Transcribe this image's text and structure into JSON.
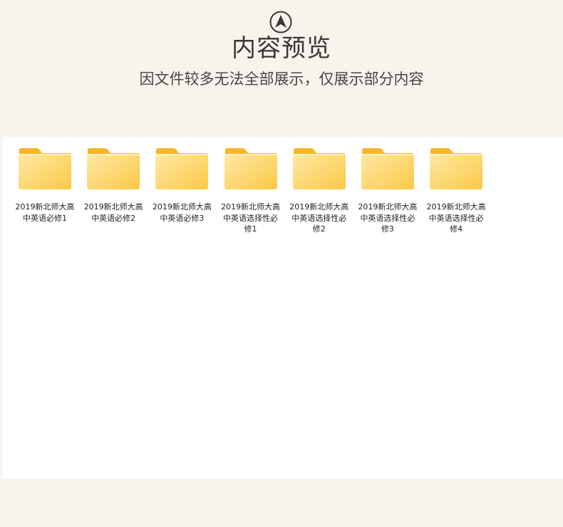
{
  "header": {
    "logo_icon": "up-arrow-circle-icon",
    "title": "内容预览",
    "subtitle": "因文件较多无法全部展示，仅展示部分内容"
  },
  "folders": [
    {
      "label": "2019新北师大高中英语必修1",
      "icon": "folder-icon"
    },
    {
      "label": "2019新北师大高中英语必修2",
      "icon": "folder-icon"
    },
    {
      "label": "2019新北师大高中英语必修3",
      "icon": "folder-icon"
    },
    {
      "label": "2019新北师大高中英语选择性必修1",
      "icon": "folder-icon"
    },
    {
      "label": "2019新北师大高中英语选择性必修2",
      "icon": "folder-icon"
    },
    {
      "label": "2019新北师大高中英语选择性必修3",
      "icon": "folder-icon"
    },
    {
      "label": "2019新北师大高中英语选择性必修4",
      "icon": "folder-icon"
    }
  ],
  "colors": {
    "background": "#f7f4ee",
    "panel": "#ffffff",
    "folder_back": "#f5b82e",
    "folder_front_light": "#fde7a0",
    "folder_front_dark": "#fbc94d",
    "text_dark": "#3d3733"
  }
}
